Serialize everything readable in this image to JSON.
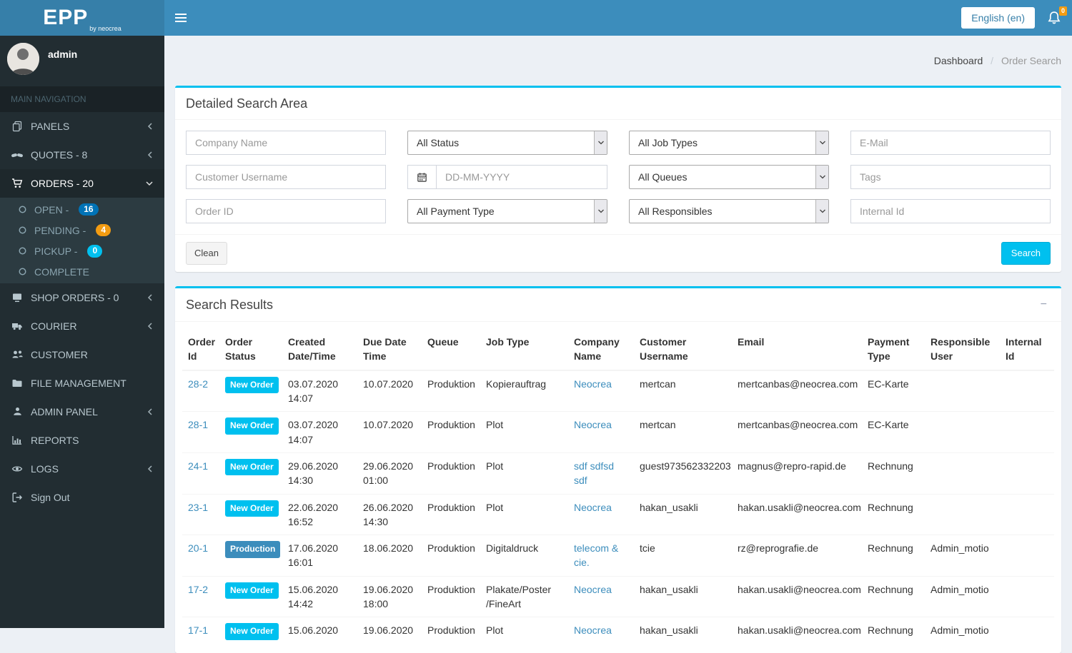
{
  "topbar": {
    "brand": "EPP",
    "brand_sub": "by neocrea",
    "language_button": "English (en)",
    "notification_badge": "0"
  },
  "sidebar": {
    "username": "admin",
    "nav_header": "MAIN NAVIGATION",
    "panels": "PANELS",
    "quotes": "QUOTES - 8",
    "orders": "ORDERS - 20",
    "open_label": "OPEN -",
    "open_badge": "16",
    "pending_label": "PENDING -",
    "pending_badge": "4",
    "pickup_label": "PICKUP -",
    "pickup_badge": "0",
    "complete_label": "COMPLETE",
    "shop_orders": "SHOP ORDERS - 0",
    "courier": "COURIER",
    "customer": "CUSTOMER",
    "file_management": "FILE MANAGEMENT",
    "admin_panel": "ADMIN PANEL",
    "reports": "REPORTS",
    "logs": "LOGS",
    "sign_out": "Sign Out"
  },
  "breadcrumb": {
    "home": "Dashboard",
    "separator": "/",
    "current": "Order Search"
  },
  "search": {
    "title": "Detailed Search Area",
    "company_placeholder": "Company Name",
    "status_value": "All Status",
    "jobtypes_value": "All Job Types",
    "email_placeholder": "E-Mail",
    "customer_placeholder": "Customer Username",
    "date_placeholder": "DD-MM-YYYY",
    "queues_value": "All Queues",
    "tags_placeholder": "Tags",
    "orderid_placeholder": "Order ID",
    "payment_value": "All Payment Type",
    "responsibles_value": "All Responsibles",
    "internalid_placeholder": "Internal Id",
    "clean_label": "Clean",
    "search_label": "Search"
  },
  "results": {
    "title": "Search Results",
    "collapse_glyph": "−",
    "columns": [
      "Order Id",
      "Order Status",
      "Created Date/Time",
      "Due Date Time",
      "Queue",
      "Job Type",
      "Company Name",
      "Customer Username",
      "Email",
      "Payment Type",
      "Responsible User",
      "Internal Id"
    ],
    "rows": [
      {
        "id": "28-2",
        "status": "New Order",
        "status_color": "#00c0ef",
        "created_date": "03.07.2020",
        "created_time": "14:07",
        "due_date": "10.07.2020",
        "due_time": "",
        "queue": "Produktion",
        "job_type": "Kopierauftrag",
        "company": "Neocrea",
        "customer": "mertcan",
        "email": "mertcanbas@neocrea.com",
        "payment": "EC-Karte",
        "responsible": "",
        "internal": ""
      },
      {
        "id": "28-1",
        "status": "New Order",
        "status_color": "#00c0ef",
        "created_date": "03.07.2020",
        "created_time": "14:07",
        "due_date": "10.07.2020",
        "due_time": "",
        "queue": "Produktion",
        "job_type": "Plot",
        "company": "Neocrea",
        "customer": "mertcan",
        "email": "mertcanbas@neocrea.com",
        "payment": "EC-Karte",
        "responsible": "",
        "internal": ""
      },
      {
        "id": "24-1",
        "status": "New Order",
        "status_color": "#00c0ef",
        "created_date": "29.06.2020",
        "created_time": "14:30",
        "due_date": "29.06.2020",
        "due_time": "01:00",
        "queue": "Produktion",
        "job_type": "Plot",
        "company": "sdf sdfsd sdf",
        "customer": "guest973562332203",
        "email": "magnus@repro-rapid.de",
        "payment": "Rechnung",
        "responsible": "",
        "internal": ""
      },
      {
        "id": "23-1",
        "status": "New Order",
        "status_color": "#00c0ef",
        "created_date": "22.06.2020",
        "created_time": "16:52",
        "due_date": "26.06.2020",
        "due_time": "14:30",
        "queue": "Produktion",
        "job_type": "Plot",
        "company": "Neocrea",
        "customer": "hakan_usakli",
        "email": "hakan.usakli@neocrea.com",
        "payment": "Rechnung",
        "responsible": "",
        "internal": ""
      },
      {
        "id": "20-1",
        "status": "Production",
        "status_color": "#3c8dbc",
        "created_date": "17.06.2020",
        "created_time": "16:01",
        "due_date": "18.06.2020",
        "due_time": "",
        "queue": "Produktion",
        "job_type": "Digitaldruck",
        "company": "telecom & cie.",
        "customer": "tcie",
        "email": "rz@reprografie.de",
        "payment": "Rechnung",
        "responsible": "Admin_motio",
        "internal": ""
      },
      {
        "id": "17-2",
        "status": "New Order",
        "status_color": "#00c0ef",
        "created_date": "15.06.2020",
        "created_time": "14:42",
        "due_date": "19.06.2020",
        "due_time": "18:00",
        "queue": "Produktion",
        "job_type": "Plakate/Poster /FineArt",
        "company": "Neocrea",
        "customer": "hakan_usakli",
        "email": "hakan.usakli@neocrea.com",
        "payment": "Rechnung",
        "responsible": "Admin_motio",
        "internal": ""
      },
      {
        "id": "17-1",
        "status": "New Order",
        "status_color": "#00c0ef",
        "created_date": "15.06.2020",
        "created_time": "",
        "due_date": "19.06.2020",
        "due_time": "",
        "queue": "Produktion",
        "job_type": "Plot",
        "company": "Neocrea",
        "customer": "hakan_usakli",
        "email": "hakan.usakli@neocrea.com",
        "payment": "Rechnung",
        "responsible": "Admin_motio",
        "internal": ""
      }
    ]
  },
  "colors": {
    "navbar": "#3c8dbc",
    "logo_bg": "#367fa9",
    "sidebar_bg": "#222d32",
    "accent": "#00c0ef",
    "badge_open": "#0073b7",
    "badge_pending": "#f39c12",
    "badge_pickup": "#00c0ef",
    "notification": "#f39c12"
  }
}
